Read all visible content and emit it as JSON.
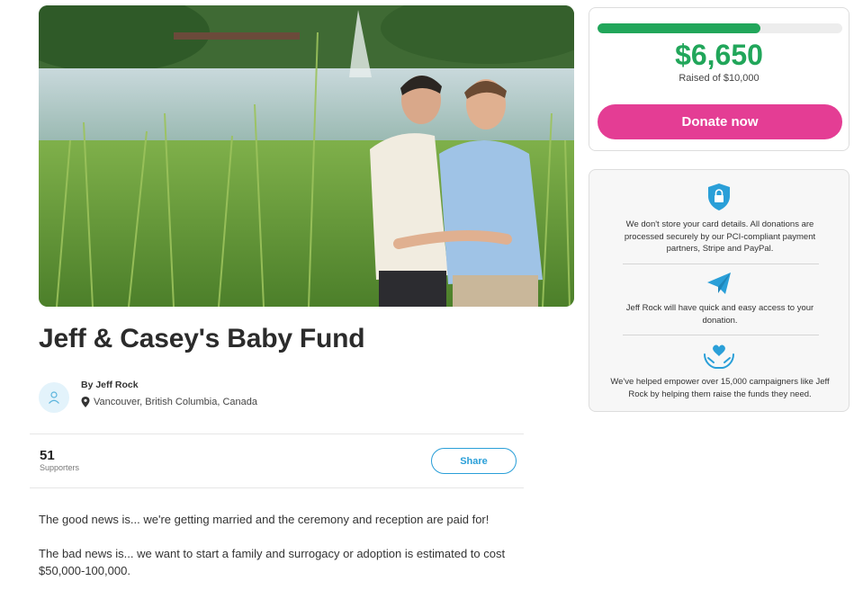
{
  "campaign": {
    "title": "Jeff & Casey's Baby Fund",
    "hero_image": "photo-couple-by-pond",
    "organizer": "By Jeff Rock",
    "location": "Vancouver, British Columbia, Canada",
    "supporters_count": "51",
    "supporters_label": "Supporters",
    "share_label": "Share",
    "story": [
      "The good news is... we're getting married and the ceremony and reception are paid for!",
      "The bad news is... we want to start a family and surrogacy or adoption is estimated to cost $50,000-100,000."
    ]
  },
  "donation": {
    "raised": "$6,650",
    "goal_text": "Raised of $10,000",
    "progress_fraction": 0.665,
    "donate_label": "Donate now",
    "colors": {
      "progress": "#21a65a",
      "donate_button": "#e43d94",
      "accent_blue": "#2a9fd8"
    }
  },
  "trust": [
    {
      "icon": "shield-lock-icon",
      "text": "We don't store your card details. All donations are processed securely by our PCI-compliant payment partners, Stripe and PayPal."
    },
    {
      "icon": "paper-plane-icon",
      "text": "Jeff Rock will have quick and easy access to your donation."
    },
    {
      "icon": "hands-heart-icon",
      "text": "We've helped empower over 15,000 campaigners like Jeff Rock by helping them raise the funds they need."
    }
  ]
}
